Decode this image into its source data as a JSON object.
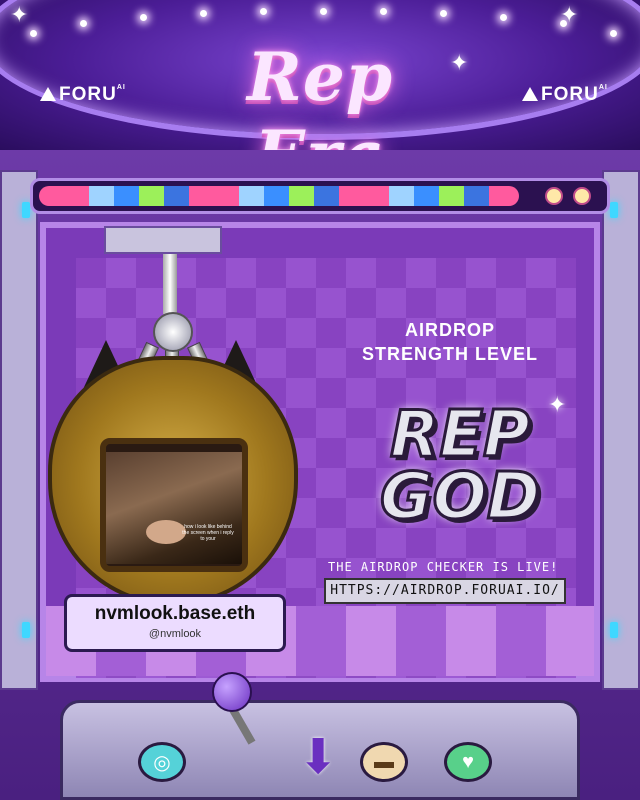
{
  "header": {
    "title": "Rep Era",
    "brand_left": "FORU",
    "brand_right": "FORU",
    "brand_sup": "AI"
  },
  "panel": {
    "subtitle_line1": "AIRDROP",
    "subtitle_line2": "STRENGTH LEVEL",
    "rank_line1": "REP",
    "rank_line2": "GOD",
    "live_text": "THE AIRDROP CHECKER IS LIVE!",
    "url": "HTTPS://AIRDROP.FORUAI.IO/"
  },
  "profile": {
    "name": "nvmlook.base.eth",
    "handle": "@nvmlook",
    "screen_caption": "how i look like behind the screen when i reply to your"
  },
  "controls": {
    "left_button_icon": "spiral-icon",
    "middle_button_icon": "coin-slot-icon",
    "right_button_icon": "heart-icon",
    "arrow_icon": "down-arrow-icon"
  },
  "colors": {
    "accent": "#7b3ab8",
    "marquee_text": "#fbe6ff",
    "progress_pink": "#ff5a9e"
  }
}
